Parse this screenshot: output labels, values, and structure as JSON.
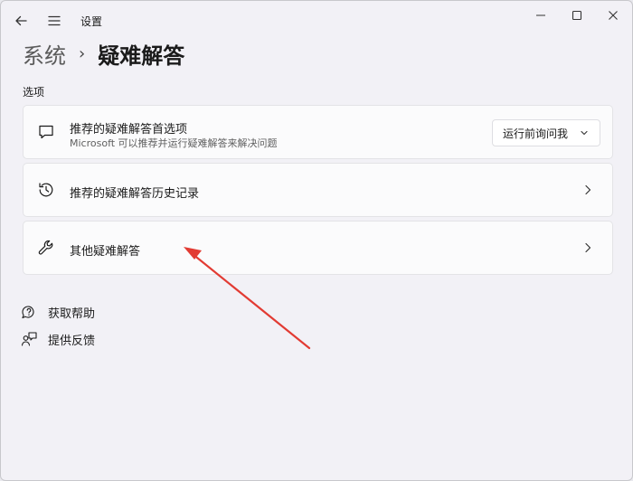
{
  "window": {
    "title": "设置",
    "controls": [
      "minimize",
      "maximize",
      "close"
    ]
  },
  "breadcrumb": {
    "parent": "系统",
    "separator": "›",
    "current": "疑难解答"
  },
  "section": {
    "label": "选项"
  },
  "cards": [
    {
      "title": "推荐的疑难解答首选项",
      "subtitle": "Microsoft 可以推荐并运行疑难解答来解决问题",
      "icon": "chat-bubble-icon",
      "dropdown": {
        "value": "运行前询问我"
      }
    },
    {
      "title": "推荐的疑难解答历史记录",
      "icon": "history-icon"
    },
    {
      "title": "其他疑难解答",
      "icon": "wrench-icon"
    }
  ],
  "links": [
    {
      "label": "获取帮助",
      "icon": "help-icon"
    },
    {
      "label": "提供反馈",
      "icon": "feedback-icon"
    }
  ],
  "colors": {
    "background": "#f2f1f6",
    "card": "#fbfbfc",
    "annotation_arrow": "#e23b33"
  }
}
